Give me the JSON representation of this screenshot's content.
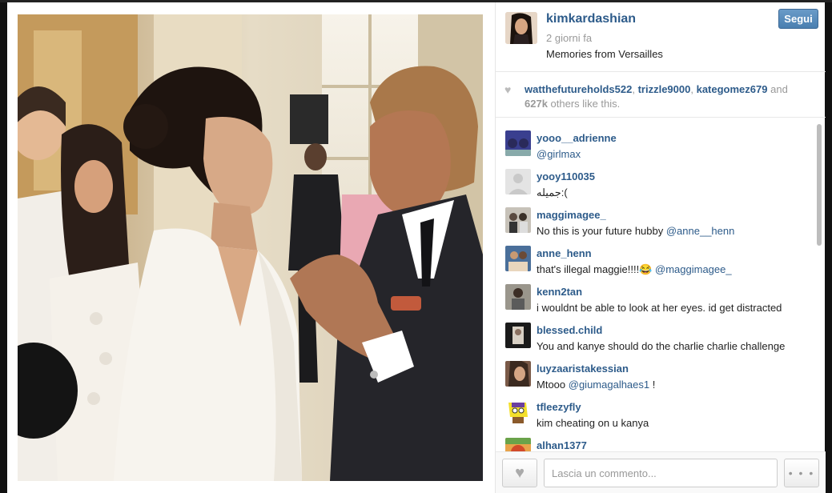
{
  "post": {
    "username": "kimkardashian",
    "time_ago": "2 giorni fa",
    "caption": "Memories from Versailles",
    "follow_label": "Segui"
  },
  "likes": {
    "users": [
      "watthefutureholds522",
      "trizzle9000",
      "kategomez679"
    ],
    "and_word": "and",
    "count": "627k",
    "suffix": "others like this."
  },
  "comments": [
    {
      "user": "yooo__adrienne",
      "text": "",
      "mention": "@girlmax",
      "after": ""
    },
    {
      "user": "yooy110035",
      "text": "جميله:(",
      "mention": "",
      "after": ""
    },
    {
      "user": "maggimagee_",
      "text": "No this is your future hubby ",
      "mention": "@anne__henn",
      "after": ""
    },
    {
      "user": "anne_henn",
      "text": "that's illegal maggie!!!!😂 ",
      "mention": "@maggimagee_",
      "after": ""
    },
    {
      "user": "kenn2tan",
      "text": "i wouldnt be able to look at her eyes. id get distracted",
      "mention": "",
      "after": ""
    },
    {
      "user": "blessed.child",
      "text": "You and kanye should do the charlie charlie challenge",
      "mention": "",
      "after": ""
    },
    {
      "user": "luyzaaristakessian",
      "text": "Mtooo ",
      "mention": "@giumagalhaes1",
      "after": " !"
    },
    {
      "user": "tfleezyfly",
      "text": "kim cheating on u kanya",
      "mention": "",
      "after": ""
    },
    {
      "user": "alhan1377",
      "text": "",
      "mention": "",
      "after": ""
    }
  ],
  "footer": {
    "comment_placeholder": "Lascia un commento...",
    "more_label": "• • •"
  },
  "colors": {
    "link": "#2d5b8a",
    "follow_button": "#5a8dbd"
  },
  "icons": {
    "like_icon": "heart-icon",
    "more_icon": "ellipsis-icon"
  }
}
